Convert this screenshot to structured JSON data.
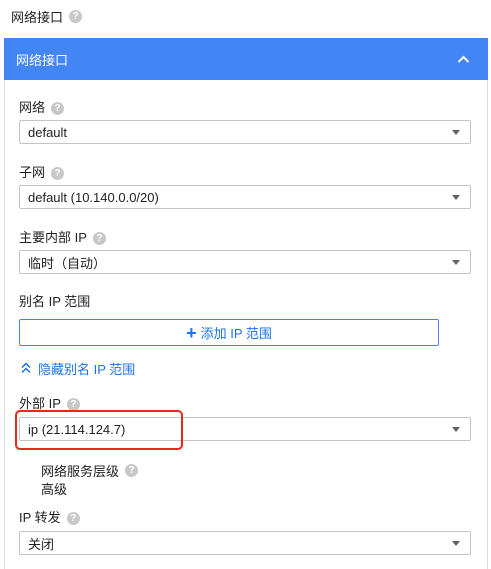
{
  "page": {
    "title": "网络接口"
  },
  "card": {
    "header_title": "网络接口"
  },
  "network": {
    "label": "网络",
    "value": "default"
  },
  "subnet": {
    "label": "子网",
    "value": "default (10.140.0.0/20)"
  },
  "primary_ip": {
    "label": "主要内部 IP",
    "value": "临时（自动）"
  },
  "alias_ip": {
    "label": "别名 IP 范围",
    "add_button": "添加 IP 范围",
    "hide_link": "隐藏别名 IP 范围"
  },
  "external_ip": {
    "label": "外部 IP",
    "value": "ip (21.114.124.7)"
  },
  "network_tier": {
    "label": "网络服务层级",
    "value": "高级"
  },
  "ip_forwarding": {
    "label": "IP 转发",
    "value": "关闭"
  },
  "help_glyph": "?",
  "colors": {
    "accent": "#4285f4",
    "link": "#1a73e8",
    "highlight": "#e8271f"
  }
}
